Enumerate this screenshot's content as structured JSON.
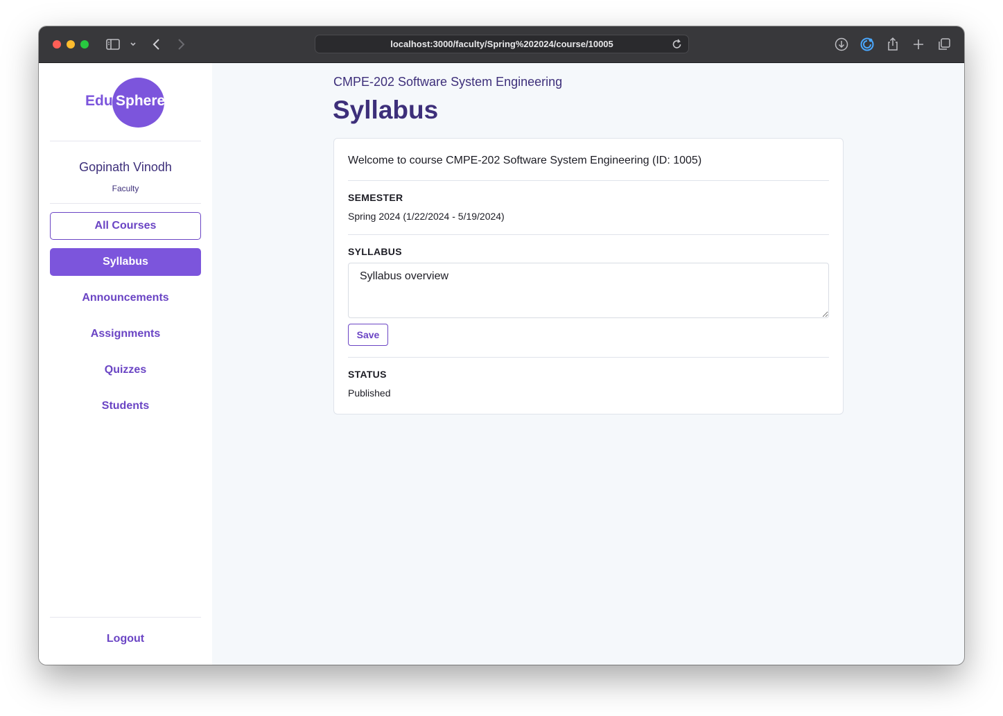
{
  "browser": {
    "url": "localhost:3000/faculty/Spring%202024/course/10005"
  },
  "logo": {
    "part1": "Edu",
    "part2": "Sphere"
  },
  "user": {
    "name": "Gopinath Vinodh",
    "role": "Faculty"
  },
  "nav": {
    "items": [
      {
        "label": "All Courses",
        "state": "outline"
      },
      {
        "label": "Syllabus",
        "state": "active"
      },
      {
        "label": "Announcements",
        "state": "normal"
      },
      {
        "label": "Assignments",
        "state": "normal"
      },
      {
        "label": "Quizzes",
        "state": "normal"
      },
      {
        "label": "Students",
        "state": "normal"
      }
    ],
    "logout": "Logout"
  },
  "page": {
    "course_title": "CMPE-202 Software System Engineering",
    "title": "Syllabus"
  },
  "card": {
    "welcome": "Welcome to course CMPE-202 Software System Engineering (ID: 1005)",
    "semester_label": "SEMESTER",
    "semester_value": "Spring 2024 (1/22/2024 - 5/19/2024)",
    "syllabus_label": "SYLLABUS",
    "syllabus_value": "Syllabus overview",
    "save_label": "Save",
    "status_label": "STATUS",
    "status_value": "Published"
  },
  "colors": {
    "accent": "#7c55dc",
    "accent_text": "#6a44c4",
    "heading": "#3d2f7a",
    "background": "#f5f8fb"
  }
}
